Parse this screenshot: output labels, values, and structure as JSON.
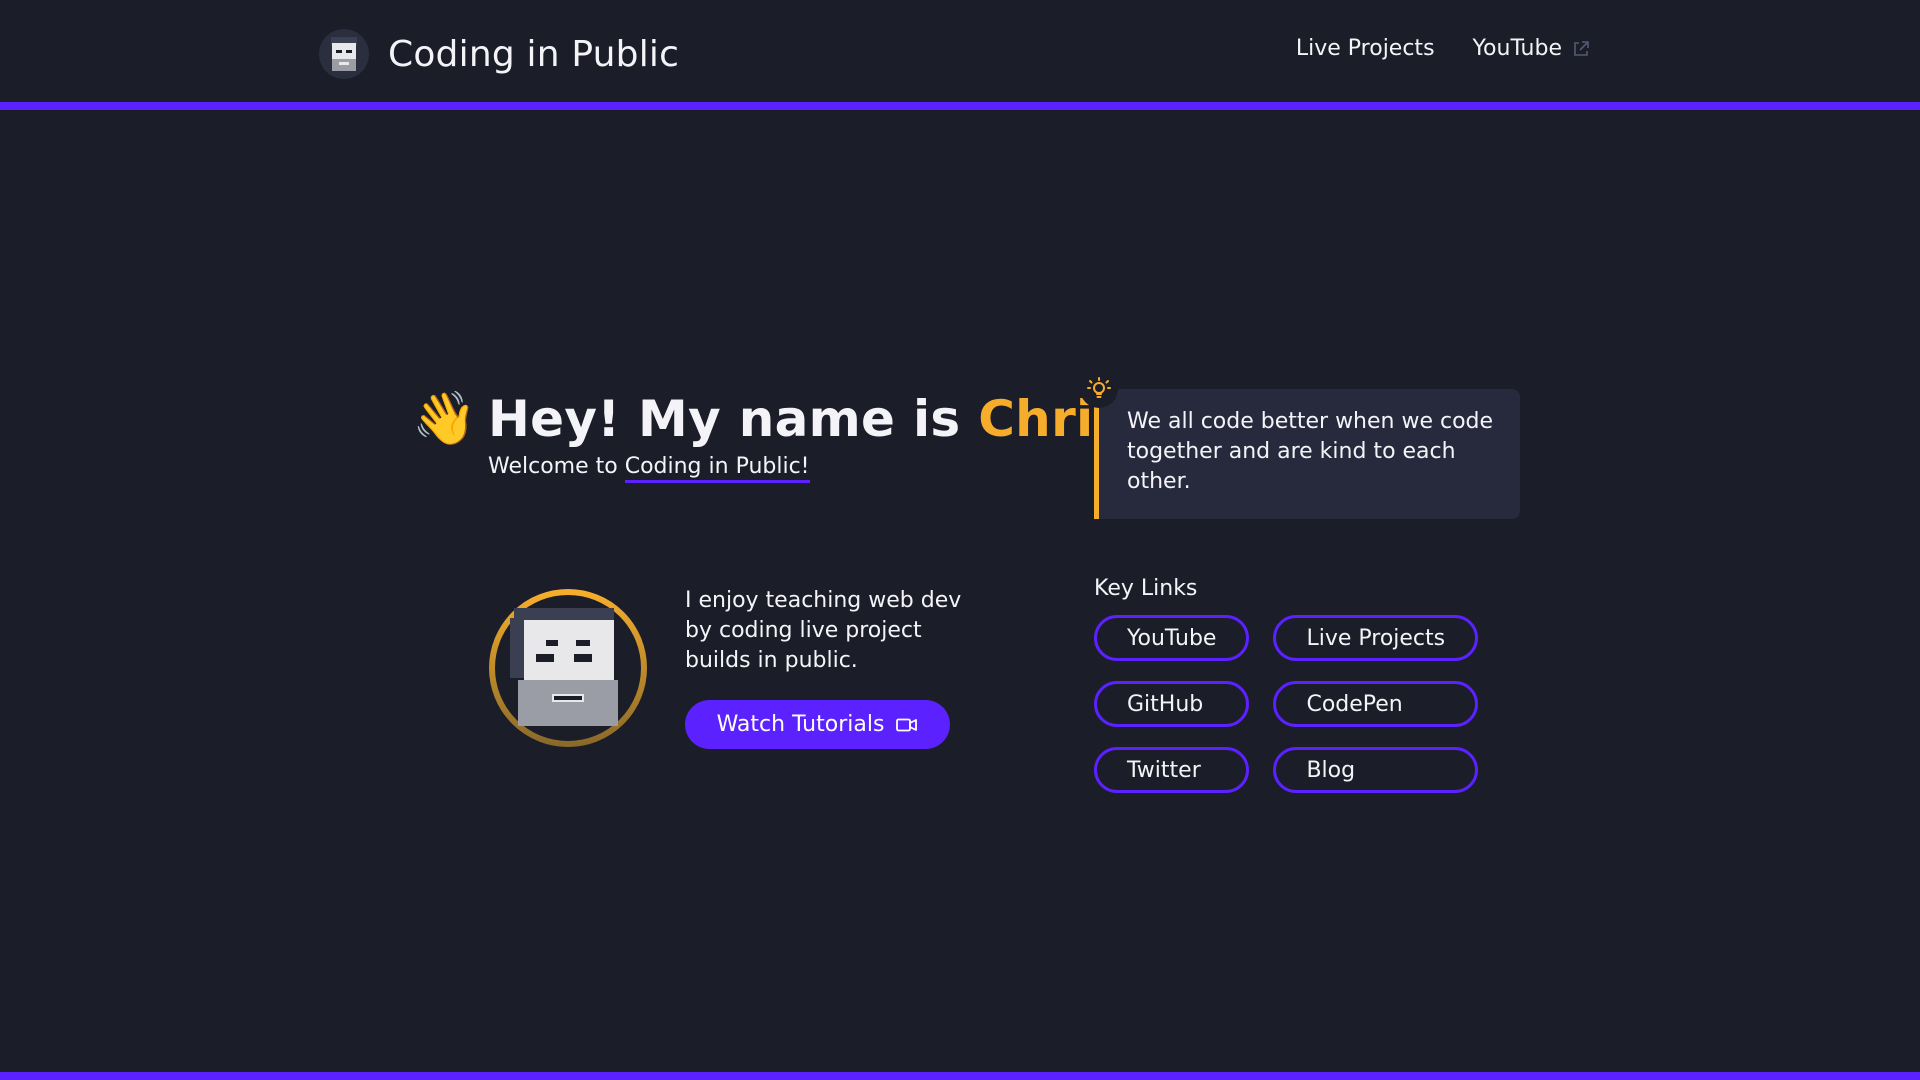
{
  "header": {
    "brand_title": "Coding in Public",
    "nav": [
      {
        "label": "Live Projects"
      },
      {
        "label": "YouTube",
        "external": true
      }
    ]
  },
  "hero": {
    "wave_emoji": "👋",
    "title_prefix": "Hey! My name is ",
    "title_name": "Chris.",
    "welcome_prefix": "Welcome to ",
    "welcome_link": "Coding in Public!"
  },
  "quote": {
    "text": "We all code better when we code together and are kind to each other.",
    "icon": "lightbulb-icon"
  },
  "intro": {
    "text": "I enjoy teaching web dev by coding live project builds in public.",
    "button_label": "Watch Tutorials",
    "button_icon": "video-camera-icon"
  },
  "key_links": {
    "heading": "Key Links",
    "items": [
      {
        "label": "YouTube"
      },
      {
        "label": "Live Projects"
      },
      {
        "label": "GitHub"
      },
      {
        "label": "CodePen"
      },
      {
        "label": "Twitter"
      },
      {
        "label": "Blog"
      }
    ]
  },
  "colors": {
    "background": "#1b1d28",
    "accent_purple": "#5b21ff",
    "accent_orange": "#f6ad2b",
    "card": "#272a3d",
    "text": "#f4f4f8"
  }
}
